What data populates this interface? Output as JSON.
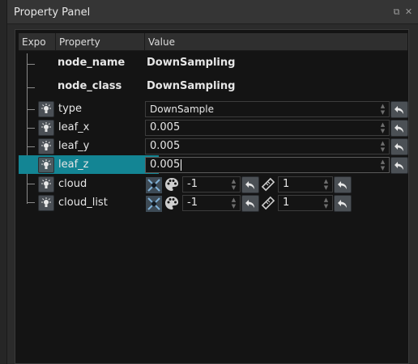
{
  "window": {
    "title": "Property Panel"
  },
  "columns": {
    "expo": "Expo",
    "property": "Property",
    "value": "Value"
  },
  "fixed_rows": [
    {
      "name": "node_name",
      "value": "DownSampling"
    },
    {
      "name": "node_class",
      "value": "DownSampling"
    }
  ],
  "rows": {
    "type": {
      "name": "type",
      "value": "DownSample"
    },
    "leaf_x": {
      "name": "leaf_x",
      "value": "0.005"
    },
    "leaf_y": {
      "name": "leaf_y",
      "value": "0.005"
    },
    "leaf_z": {
      "name": "leaf_z",
      "value": "0.005"
    },
    "cloud": {
      "name": "cloud",
      "value_a": "-1",
      "value_b": "1"
    },
    "cloud_list": {
      "name": "cloud_list",
      "value_a": "-1",
      "value_b": "1"
    }
  },
  "selected_row": "leaf_z",
  "colors": {
    "selection": "#138594",
    "background": "#141414",
    "header": "#2f2f2f"
  },
  "icons": [
    "expose-bulb-icon",
    "undo-arrow-icon",
    "palette-icon",
    "disconnected-icon",
    "ruler-icon",
    "float-restore-icon",
    "close-icon"
  ]
}
